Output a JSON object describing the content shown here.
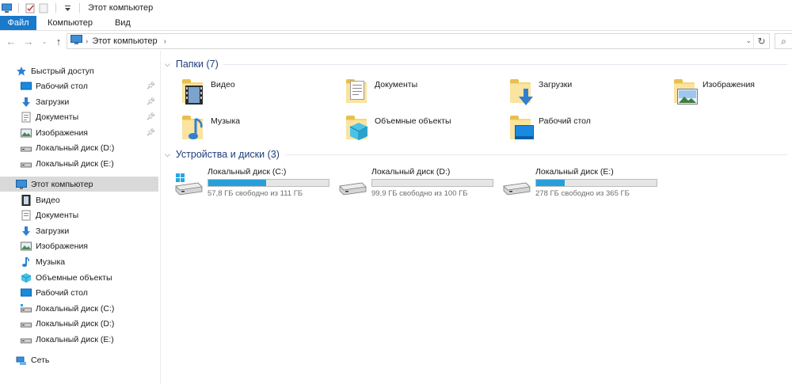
{
  "titlebar": {
    "title": "Этот компьютер"
  },
  "ribbon": {
    "tabs": [
      "Файл",
      "Компьютер",
      "Вид"
    ]
  },
  "address": {
    "crumb": "Этот компьютер"
  },
  "sidebar": {
    "quick_access": "Быстрый доступ",
    "quick_items": [
      "Рабочий стол",
      "Загрузки",
      "Документы",
      "Изображения",
      "Локальный диск (D:)",
      "Локальный диск (E:)"
    ],
    "this_pc": "Этот компьютер",
    "pc_items": [
      "Видео",
      "Документы",
      "Загрузки",
      "Изображения",
      "Музыка",
      "Объемные объекты",
      "Рабочий стол",
      "Локальный диск (C:)",
      "Локальный диск (D:)",
      "Локальный диск (E:)"
    ],
    "network": "Сеть"
  },
  "main": {
    "folders_header": "Папки (7)",
    "folders": [
      "Видео",
      "Документы",
      "Загрузки",
      "Изображения",
      "Музыка",
      "Объемные объекты",
      "Рабочий стол"
    ],
    "drives_header": "Устройства и диски (3)",
    "drives": [
      {
        "name": "Локальный диск (C:)",
        "free": "57,8 ГБ свободно из 111 ГБ",
        "used_fraction": 0.48
      },
      {
        "name": "Локальный диск (D:)",
        "free": "99,9 ГБ свободно из 100 ГБ",
        "used_fraction": 0.0
      },
      {
        "name": "Локальный диск (E:)",
        "free": "278 ГБ свободно из 365 ГБ",
        "used_fraction": 0.24
      }
    ]
  },
  "colors": {
    "accent": "#1979ca",
    "bar_fill": "#26a0da",
    "folder": "#f7d774",
    "header": "#1e3d7a"
  }
}
